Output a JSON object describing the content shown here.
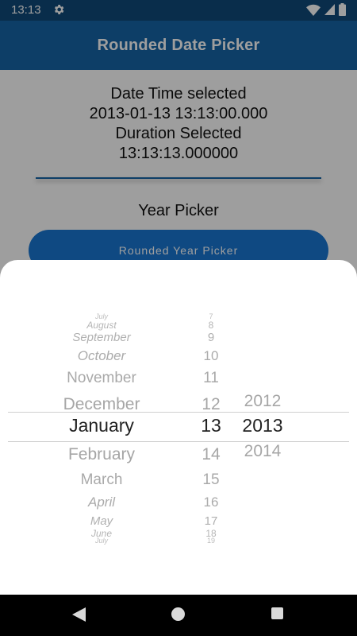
{
  "status_bar": {
    "time": "13:13",
    "settings_icon": "gear-icon",
    "icons": [
      "wifi-icon",
      "signal-icon",
      "battery-icon"
    ]
  },
  "app_bar": {
    "title": "Rounded Date Picker",
    "color": "#1565a6"
  },
  "info": {
    "date_label": "Date Time selected",
    "date_value": "2013-01-13 13:13:00.000",
    "duration_label": "Duration Selected",
    "duration_value": "13:13:13.000000"
  },
  "year_section": {
    "title": "Year Picker",
    "button_label": "Rounded Year Picker"
  },
  "picker": {
    "months_above": [
      "July",
      "August",
      "September",
      "October",
      "November",
      "December"
    ],
    "selected_month": "January",
    "months_below": [
      "February",
      "March",
      "April",
      "May",
      "June",
      "July"
    ],
    "days_above": [
      "7",
      "8",
      "9",
      "10",
      "11",
      "12"
    ],
    "selected_day": "13",
    "days_below": [
      "14",
      "15",
      "16",
      "17",
      "18",
      "19"
    ],
    "year_above": "2012",
    "selected_year": "2013",
    "year_below": "2014"
  },
  "nav_bar": {
    "icons": [
      "back-icon",
      "home-icon",
      "recents-icon"
    ]
  }
}
